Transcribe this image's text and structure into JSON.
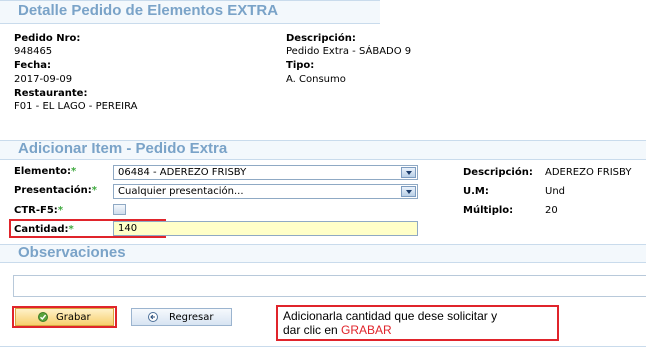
{
  "header": {
    "title": "Detalle Pedido de Elementos EXTRA"
  },
  "details": {
    "pedido_label": "Pedido Nro:",
    "pedido_value": "948465",
    "fecha_label": "Fecha:",
    "fecha_value": "2017-09-09",
    "restaurante_label": "Restaurante:",
    "restaurante_value": "F01 - EL LAGO - PEREIRA",
    "descripcion_label": "Descripción:",
    "descripcion_value": "Pedido Extra - SÁBADO 9",
    "tipo_label": "Tipo:",
    "tipo_value": "A. Consumo"
  },
  "add_item": {
    "title": "Adicionar Item - Pedido Extra",
    "required_mark": "*",
    "elemento_label": "Elemento:",
    "elemento_value": "06484 - ADEREZO FRISBY",
    "presentacion_label": "Presentación:",
    "presentacion_value": "Cualquier presentación...",
    "ctr_label": "CTR-F5:",
    "cantidad_label": "Cantidad:",
    "cantidad_value": "140",
    "desc_label": "Descripción:",
    "desc_value": "ADEREZO FRISBY",
    "um_label": "U.M:",
    "um_value": "Und",
    "multiplo_label": "Múltiplo:",
    "multiplo_value": "20"
  },
  "observaciones": {
    "title": "Observaciones",
    "value": ""
  },
  "actions": {
    "grabar_label": "Grabar",
    "regresar_label": "Regresar"
  },
  "annotation": {
    "text_line1": "Adicionarla cantidad que dese solicitar y",
    "text_line2_prefix": "dar clic en ",
    "text_line2_highlight": "GRABAR"
  },
  "colors": {
    "section_title": "#7aa3c8",
    "highlight_box": "#e0242b",
    "required_star": "#3ea93e",
    "input_highlight": "#ffffc8"
  }
}
